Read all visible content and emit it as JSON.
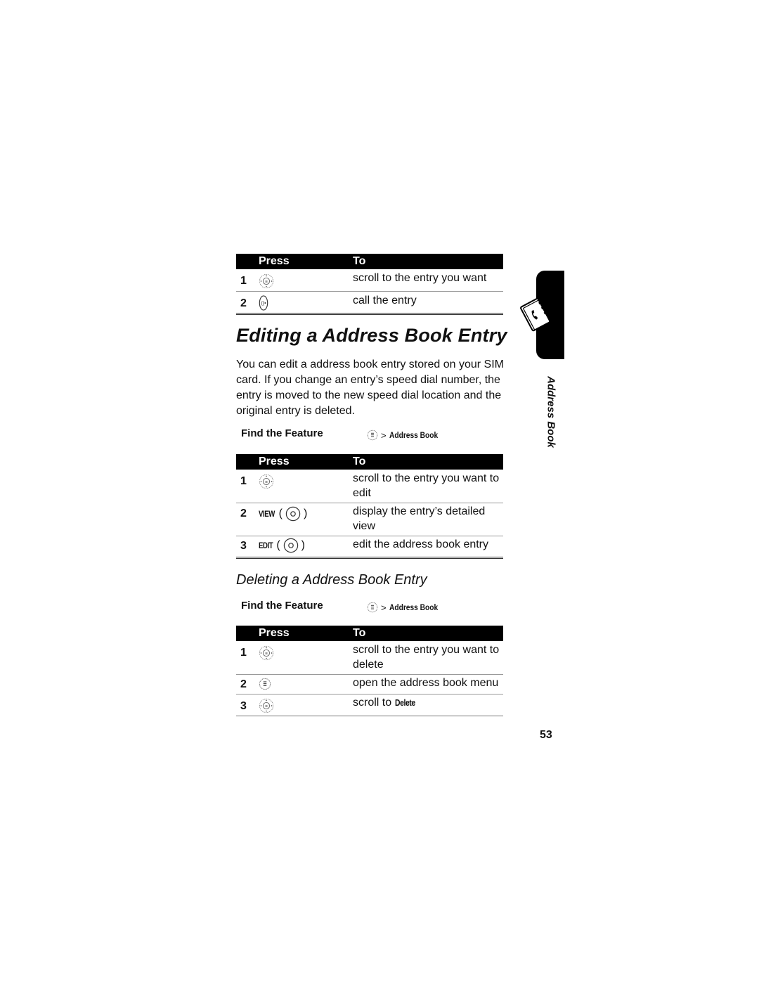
{
  "table1": {
    "header": {
      "press": "Press",
      "to": "To"
    },
    "rows": [
      {
        "num": "1",
        "press_icon": "nav-key-icon",
        "to": "scroll to the entry you want"
      },
      {
        "num": "2",
        "press_icon": "send-key-icon",
        "to": "call the entry"
      }
    ]
  },
  "editing": {
    "title": "Editing a Address Book Entry",
    "paragraph": "You can edit a address book entry stored on your SIM card. If you change an entry’s speed dial number, the entry is moved to the new speed dial location and the original entry is deleted.",
    "find_feature": {
      "label": "Find the Feature",
      "separator": ">",
      "path": "Address Book",
      "icon": "menu-key-icon"
    },
    "table": {
      "header": {
        "press": "Press",
        "to": "To"
      },
      "rows": [
        {
          "num": "1",
          "press_icon": "nav-key-icon",
          "to": "scroll to the entry you want to edit"
        },
        {
          "num": "2",
          "softkey": "VIEW",
          "press_icon": "center-key-icon",
          "to": "display the entry’s detailed view"
        },
        {
          "num": "3",
          "softkey": "EDIT",
          "press_icon": "center-key-icon",
          "to": "edit the address book entry"
        }
      ]
    }
  },
  "deleting": {
    "title": "Deleting a Address Book Entry",
    "find_feature": {
      "label": "Find the Feature",
      "separator": ">",
      "path": "Address Book",
      "icon": "menu-key-icon"
    },
    "table": {
      "header": {
        "press": "Press",
        "to": "To"
      },
      "rows": [
        {
          "num": "1",
          "press_icon": "nav-key-icon",
          "to": "scroll to the entry you want to delete"
        },
        {
          "num": "2",
          "press_icon": "menu-key-icon",
          "to": "open the address book menu"
        },
        {
          "num": "3",
          "press_icon": "nav-key-icon",
          "to_prefix": "scroll to ",
          "to_bold": "Delete"
        }
      ]
    }
  },
  "sidebar": {
    "section_label": "Address Book",
    "icon": "address-book-icon"
  },
  "page_number": "53",
  "punct": {
    "open": "(",
    "close": ")"
  }
}
